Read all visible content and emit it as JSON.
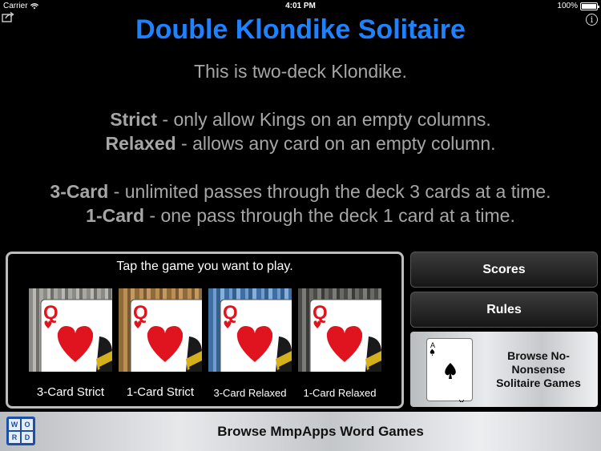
{
  "status_bar": {
    "carrier": "Carrier",
    "time": "4:01 PM",
    "battery": "100%",
    "battery_level": 1.0
  },
  "header": {
    "title": "Double Klondike Solitaire",
    "intro": "This is two-deck Klondike."
  },
  "rules_text": {
    "strict_label": "Strict",
    "strict_desc": " - only allow Kings on an empty columns.",
    "relaxed_label": "Relaxed",
    "relaxed_desc": " - allows any card on an empty column.",
    "three_card_label": "3-Card",
    "three_card_desc": " - unlimited passes through the deck 3 cards at a time.",
    "one_card_label": "1-Card",
    "one_card_desc": " - one pass through the deck 1 card at a time."
  },
  "chooser": {
    "prompt": "Tap the game you want to play.",
    "games": [
      {
        "label": "3-Card Strict"
      },
      {
        "label": "1-Card Strict"
      },
      {
        "label": "3-Card Relaxed"
      },
      {
        "label": "1-Card Relaxed"
      }
    ],
    "card_rank": "Q"
  },
  "buttons": {
    "scores": "Scores",
    "rules": "Rules",
    "browse_solitaire_line1": "Browse No-",
    "browse_solitaire_line2": "Nonsense",
    "browse_solitaire_line3": "Solitaire Games",
    "browse_card_rank": "A",
    "browse_word": "Browse MmpApps Word Games",
    "word_icon_letters": [
      "W",
      "O",
      "R",
      "D"
    ]
  },
  "colors": {
    "title_blue": "#1e82ff",
    "body_gray": "#a6a6a6",
    "heart_red": "#e0141e"
  }
}
